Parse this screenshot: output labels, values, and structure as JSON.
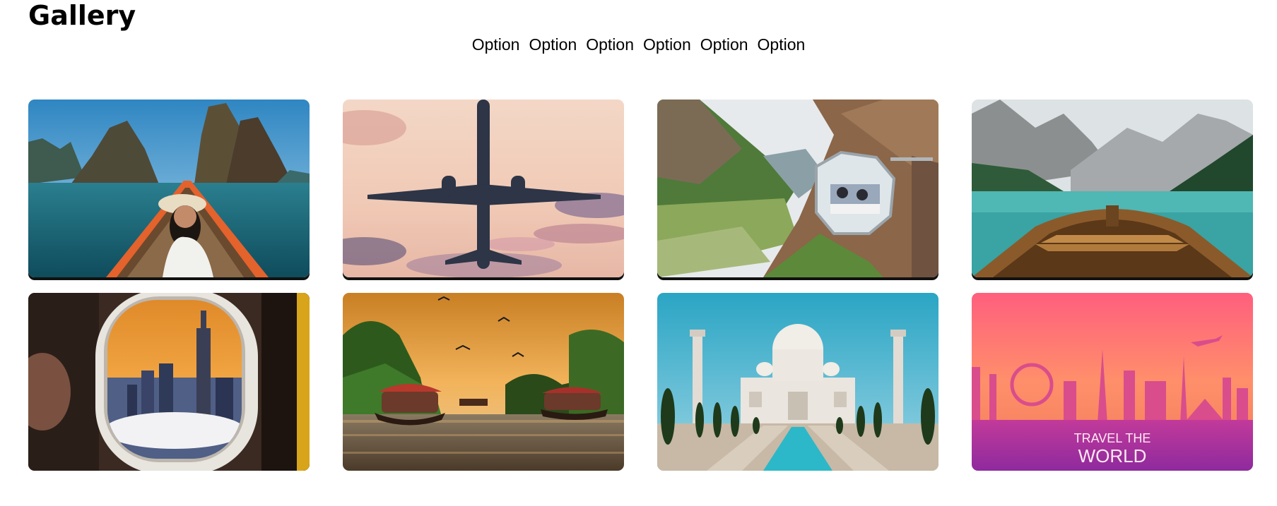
{
  "page": {
    "title": "Gallery"
  },
  "nav": {
    "items": [
      {
        "label": "Option"
      },
      {
        "label": "Option"
      },
      {
        "label": "Option"
      },
      {
        "label": "Option"
      },
      {
        "label": "Option"
      },
      {
        "label": "Option"
      }
    ]
  },
  "gallery": {
    "images": [
      {
        "name": "karst-lake-boat"
      },
      {
        "name": "airplane-sunset-sky"
      },
      {
        "name": "cliffside-glass-pod"
      },
      {
        "name": "alpine-lake-rowboat"
      },
      {
        "name": "airplane-window-city"
      },
      {
        "name": "kerala-houseboats-sunset"
      },
      {
        "name": "taj-mahal"
      },
      {
        "name": "travel-the-world-poster",
        "text_line1": "TRAVEL THE",
        "text_line2": "WORLD"
      }
    ]
  }
}
